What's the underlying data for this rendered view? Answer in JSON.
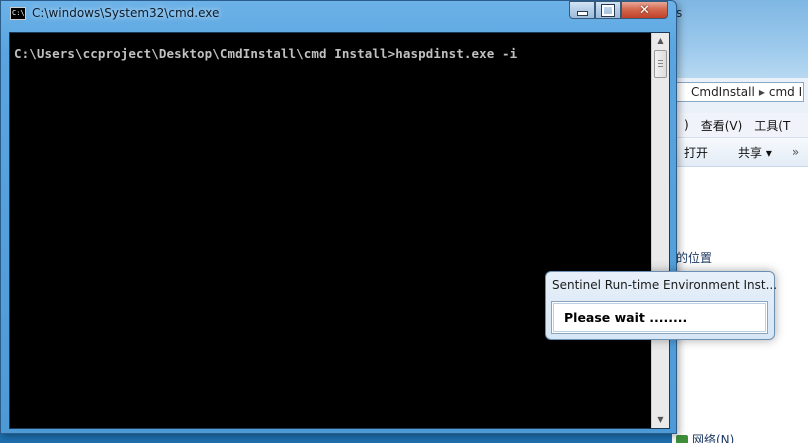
{
  "background_window": {
    "top_right_fragment": "s",
    "breadcrumb": [
      "CmdInstall",
      "cmd I"
    ],
    "menu": [
      ")",
      "查看(V)",
      "工具(T"
    ],
    "toolbar": {
      "open": "打开",
      "share": "共享 ▾",
      "more": "»"
    },
    "location_text": "的位置",
    "network_text": "网络(N)"
  },
  "cmd_window": {
    "title": "C:\\windows\\System32\\cmd.exe",
    "icon_text": "C:\\",
    "prompt_line": "C:\\Users\\ccproject\\Desktop\\CmdInstall\\cmd Install>haspdinst.exe -i",
    "buttons": {
      "minimize": "",
      "maximize": "",
      "close": "✕"
    }
  },
  "installer_dialog": {
    "title": "Sentinel Run-time Environment Inst...",
    "message": "Please wait ........"
  },
  "colors": {
    "console_bg": "#000000",
    "console_text": "#c0c0c0",
    "titlebar_blue": "#5aa5df",
    "close_red": "#c0412a"
  }
}
